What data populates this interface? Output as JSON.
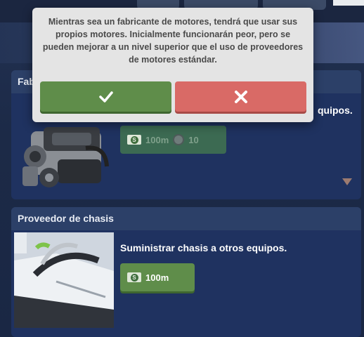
{
  "popup": {
    "message": "Mientras sea un fabricante de motores, tendrá que usar sus propios motores. Inicialmente funcionarán peor, pero se pueden mejorar a un nivel superior que el uso de proveedores de motores estándar.",
    "confirm_icon": "check-icon",
    "cancel_icon": "close-icon"
  },
  "cards": [
    {
      "title_partial": "Fab",
      "description_partial": "quipos.",
      "cost": {
        "money": "100m",
        "tokens": "10"
      },
      "illustration": "engine-icon",
      "enabled": false
    },
    {
      "title": "Proveedor de chasis",
      "description": "Suministrar chasis a otros equipos.",
      "cost": {
        "money": "100m"
      },
      "illustration": "race-car-chassis",
      "enabled": true
    }
  ],
  "icons": {
    "money": "money-icon",
    "token": "token-icon",
    "money_symbol": "S"
  },
  "colors": {
    "confirm": "#5f8d4a",
    "cancel": "#d96a66",
    "card": "#1f3260",
    "card_header": "#2c4068"
  }
}
